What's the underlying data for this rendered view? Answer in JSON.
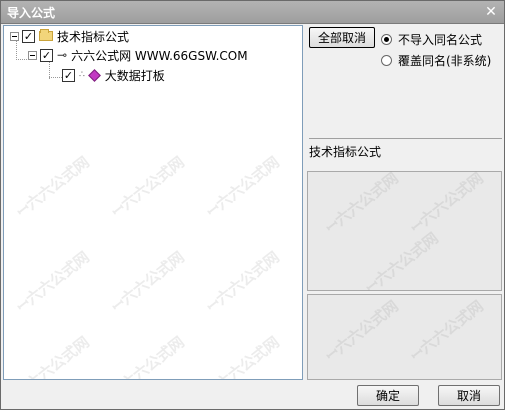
{
  "window": {
    "title": "导入公式",
    "close_glyph": "✕"
  },
  "tree": {
    "root": {
      "label": "技术指标公式",
      "checked": true,
      "icon": "folder-icon"
    },
    "level1": {
      "label": "六六公式网 WWW.66GSW.COM",
      "checked": true,
      "icon": "key-icon"
    },
    "level2": {
      "label": "大数据打板",
      "checked": true,
      "icon": "gem-icon"
    }
  },
  "options": {
    "toggle_all_label": "全部取消",
    "radio_no_import": "不导入同名公式",
    "radio_overwrite": "覆盖同名(非系统)",
    "selected_radio": "no_import"
  },
  "info": {
    "category_label": "技术指标公式"
  },
  "footer": {
    "ok_label": "确定",
    "cancel_label": "取消"
  },
  "watermark": {
    "text": "ꟷ六六公式网"
  }
}
